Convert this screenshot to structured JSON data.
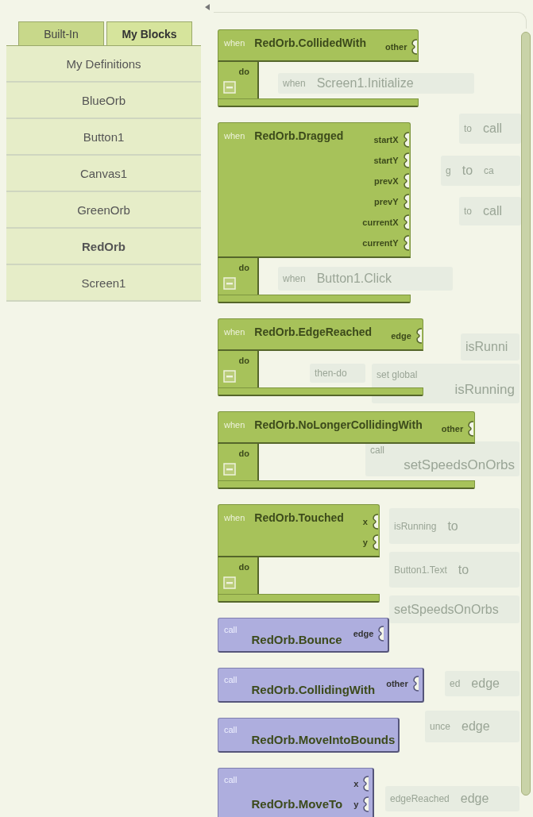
{
  "sidebar": {
    "tabs": [
      {
        "label": "Built-In",
        "selected": false
      },
      {
        "label": "My Blocks",
        "selected": true
      }
    ],
    "items": [
      {
        "label": "My Definitions",
        "selected": false
      },
      {
        "label": "BlueOrb",
        "selected": false
      },
      {
        "label": "Button1",
        "selected": false
      },
      {
        "label": "Canvas1",
        "selected": false
      },
      {
        "label": "GreenOrb",
        "selected": false
      },
      {
        "label": "RedOrb",
        "selected": true
      },
      {
        "label": "Screen1",
        "selected": false
      }
    ]
  },
  "workspace": {
    "background_blocks": [
      {
        "kind": "row",
        "texts": [
          "when",
          "Screen1.Initialize"
        ]
      },
      {
        "kind": "row",
        "texts": [
          "to",
          "call"
        ]
      },
      {
        "kind": "row",
        "texts": [
          "g",
          "to",
          "ca"
        ]
      },
      {
        "kind": "row",
        "texts": [
          "to",
          "call"
        ]
      },
      {
        "kind": "row",
        "texts": [
          "when",
          "Button1.Click"
        ]
      },
      {
        "kind": "row",
        "texts": [
          "isRunni"
        ]
      },
      {
        "kind": "label",
        "texts": [
          "then-do"
        ]
      },
      {
        "kind": "stack",
        "texts": [
          "set global",
          "isRunning"
        ]
      },
      {
        "kind": "stack",
        "texts": [
          "call",
          "setSpeedsOnOrbs"
        ]
      },
      {
        "kind": "row",
        "texts": [
          "isRunning",
          "to"
        ]
      },
      {
        "kind": "row",
        "texts": [
          "Button1.Text",
          "to"
        ]
      },
      {
        "kind": "row",
        "texts": [
          "setSpeedsOnOrbs"
        ]
      },
      {
        "kind": "row",
        "texts": [
          "ed",
          "edge"
        ]
      },
      {
        "kind": "row",
        "texts": [
          "unce",
          "edge"
        ]
      },
      {
        "kind": "row",
        "texts": [
          "edgeReached",
          "edge"
        ]
      }
    ],
    "drawer": {
      "blocks": [
        {
          "kind": "event",
          "prefix": "when",
          "name": "RedOrb.CollidedWith",
          "params": [
            "other"
          ],
          "body_label": "do"
        },
        {
          "kind": "event",
          "prefix": "when",
          "name": "RedOrb.Dragged",
          "params": [
            "startX",
            "startY",
            "prevX",
            "prevY",
            "currentX",
            "currentY"
          ],
          "body_label": "do"
        },
        {
          "kind": "event",
          "prefix": "when",
          "name": "RedOrb.EdgeReached",
          "params": [
            "edge"
          ],
          "body_label": "do"
        },
        {
          "kind": "event",
          "prefix": "when",
          "name": "RedOrb.NoLongerCollidingWith",
          "params": [
            "other"
          ],
          "body_label": "do"
        },
        {
          "kind": "event",
          "prefix": "when",
          "name": "RedOrb.Touched",
          "params": [
            "x",
            "y"
          ],
          "body_label": "do"
        },
        {
          "kind": "call",
          "prefix": "call",
          "name": "RedOrb.Bounce",
          "params": [
            "edge"
          ]
        },
        {
          "kind": "call",
          "prefix": "call",
          "name": "RedOrb.CollidingWith",
          "params": [
            "other"
          ]
        },
        {
          "kind": "call",
          "prefix": "call",
          "name": "RedOrb.MoveIntoBounds"
        },
        {
          "kind": "call",
          "prefix": "call",
          "name": "RedOrb.MoveTo",
          "params": [
            "x",
            "y"
          ]
        }
      ]
    }
  }
}
